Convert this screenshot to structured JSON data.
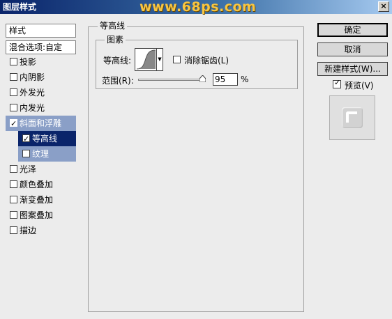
{
  "window": {
    "title": "图层样式",
    "watermark": "www.68ps.com",
    "close_label": "×"
  },
  "style_list": {
    "header": "样式",
    "blend_options": "混合选项:自定",
    "items": [
      {
        "label": "投影",
        "checked": false
      },
      {
        "label": "内阴影",
        "checked": false
      },
      {
        "label": "外发光",
        "checked": false
      },
      {
        "label": "内发光",
        "checked": false
      },
      {
        "label": "斜面和浮雕",
        "checked": true
      },
      {
        "label": "等高线",
        "checked": true
      },
      {
        "label": "纹理",
        "checked": false
      },
      {
        "label": "光泽",
        "checked": false
      },
      {
        "label": "颜色叠加",
        "checked": false
      },
      {
        "label": "渐变叠加",
        "checked": false
      },
      {
        "label": "图案叠加",
        "checked": false
      },
      {
        "label": "描边",
        "checked": false
      }
    ]
  },
  "panel": {
    "group_title": "等高线",
    "subgroup_title": "图素",
    "contour_label": "等高线:",
    "anti_alias_label": "消除锯齿(L)",
    "anti_alias_checked": false,
    "range_label": "范围(R):",
    "range_value": "95",
    "range_unit": "%"
  },
  "buttons": {
    "ok": "确定",
    "cancel": "取消",
    "new_style": "新建样式(W)..."
  },
  "preview": {
    "label": "预览(V)",
    "checked": true
  },
  "colors": {
    "title_bar": "#0a246a",
    "selected_item": "#0a246a",
    "active_group": "#8a9fc7",
    "watermark": "#f7c542"
  }
}
